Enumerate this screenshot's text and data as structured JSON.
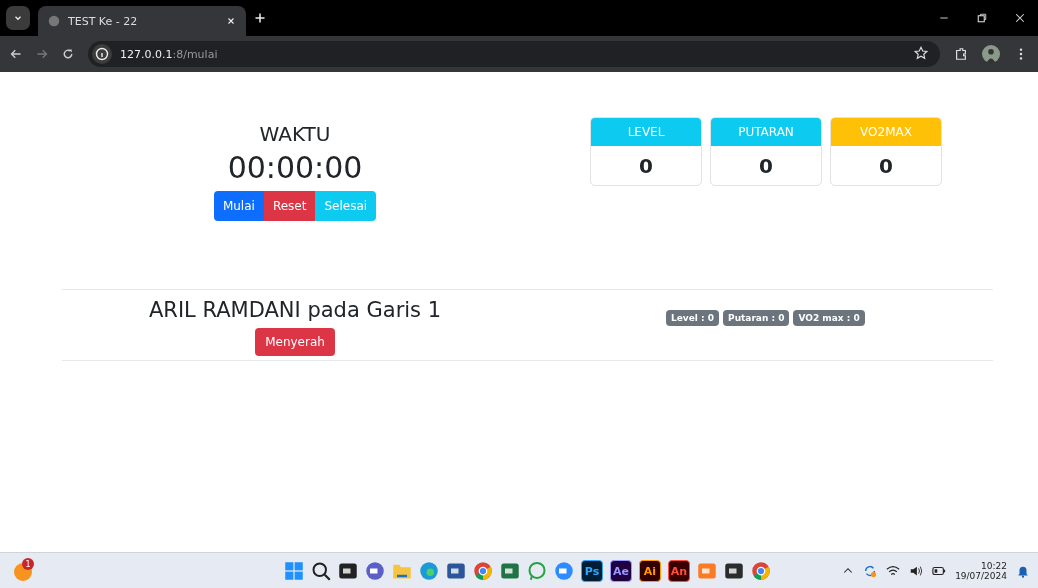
{
  "browser": {
    "tab_title": "TEST Ke - 22",
    "url_host": "127.0.0.1",
    "url_path": ":8/mulai"
  },
  "timer": {
    "title": "WAKTU",
    "time": "00:00:00",
    "buttons": [
      {
        "label": "Mulai",
        "kind": "primary"
      },
      {
        "label": "Reset",
        "kind": "danger"
      },
      {
        "label": "Selesai",
        "kind": "info"
      }
    ]
  },
  "stats": [
    {
      "label": "LEVEL",
      "value": "0",
      "kind": "info"
    },
    {
      "label": "PUTARAN",
      "value": "0",
      "kind": "info"
    },
    {
      "label": "VO2MAX",
      "value": "0",
      "kind": "warning"
    }
  ],
  "participant": {
    "name": "ARIL RAMDANI pada Garis 1",
    "button": "Menyerah",
    "badges": [
      "Level : 0",
      "Putaran : 0",
      "VO2 max : 0"
    ]
  },
  "taskbar": {
    "notification_count": "1",
    "apps": [
      {
        "kind": "start"
      },
      {
        "kind": "search"
      },
      {
        "kind": "taskview"
      },
      {
        "kind": "meet"
      },
      {
        "kind": "folder"
      },
      {
        "kind": "edge"
      },
      {
        "kind": "word"
      },
      {
        "kind": "chrome"
      },
      {
        "kind": "excel"
      },
      {
        "kind": "whatsapp"
      },
      {
        "kind": "zoom"
      },
      {
        "kind": "ps",
        "label": "Ps"
      },
      {
        "kind": "ae",
        "label": "Ae"
      },
      {
        "kind": "ai",
        "label": "Ai"
      },
      {
        "kind": "an",
        "label": "An"
      },
      {
        "kind": "xampp"
      },
      {
        "kind": "terminal"
      },
      {
        "kind": "chrome"
      }
    ],
    "time": "10:22",
    "date": "19/07/2024"
  }
}
